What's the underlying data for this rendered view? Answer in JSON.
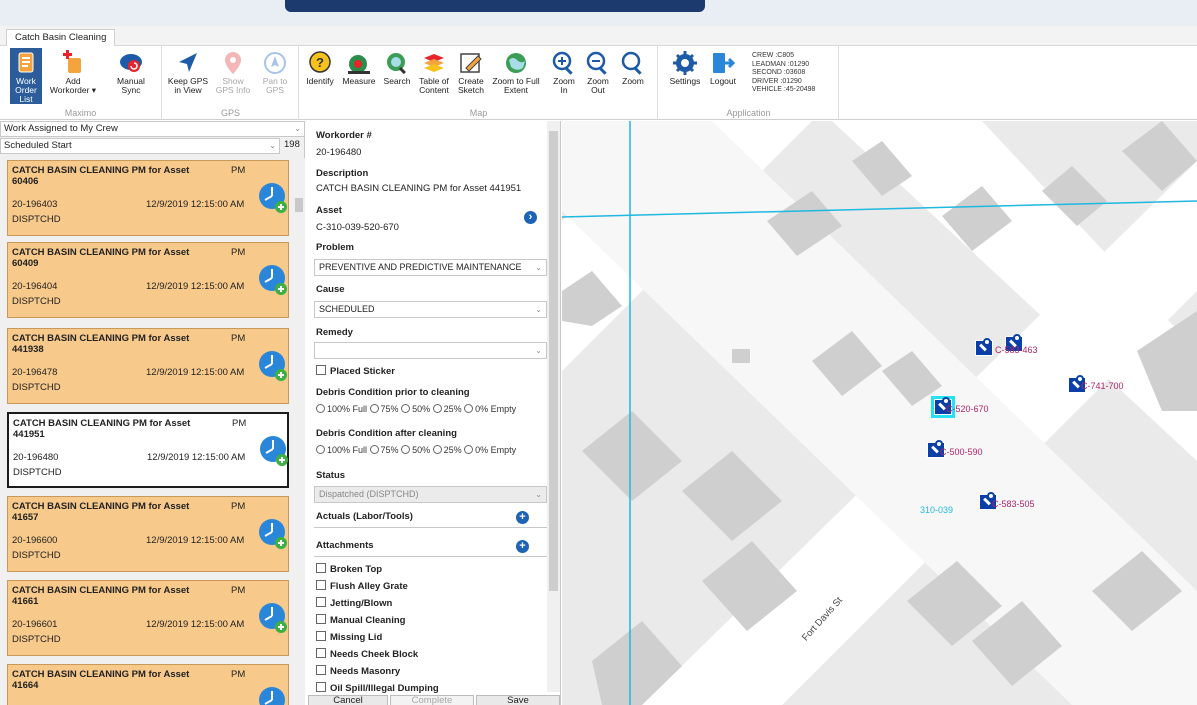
{
  "window": {
    "tab_label": "Catch Basin Cleaning"
  },
  "ribbon": {
    "groups": [
      {
        "title": "Maximo",
        "buttons": [
          {
            "label": "Work\nOrder List",
            "icon": "work-order-list-icon",
            "active": true
          },
          {
            "label": "Add\nWorkorder ▾",
            "icon": "add-workorder-icon"
          },
          {
            "label": "Manual\nSync",
            "icon": "manual-sync-icon"
          }
        ]
      },
      {
        "title": "GPS",
        "buttons": [
          {
            "label": "Keep GPS\nin View",
            "icon": "keep-gps-icon"
          },
          {
            "label": "Show\nGPS Info",
            "icon": "show-gps-info-icon",
            "disabled": true
          },
          {
            "label": "Pan to\nGPS",
            "icon": "pan-to-gps-icon",
            "disabled": true
          }
        ]
      },
      {
        "title": "Map",
        "buttons": [
          {
            "label": "Identify",
            "icon": "identify-icon"
          },
          {
            "label": "Measure",
            "icon": "measure-icon"
          },
          {
            "label": "Search",
            "icon": "search-globe-icon"
          },
          {
            "label": "Table of\nContent",
            "icon": "table-of-content-icon"
          },
          {
            "label": "Create\nSketch",
            "icon": "create-sketch-icon"
          },
          {
            "label": "Zoom to Full\nExtent",
            "icon": "zoom-full-extent-icon"
          },
          {
            "label": "Zoom\nIn",
            "icon": "zoom-in-icon"
          },
          {
            "label": "Zoom\nOut",
            "icon": "zoom-out-icon"
          },
          {
            "label": "Zoom",
            "icon": "zoom-icon"
          }
        ]
      },
      {
        "title": "Application",
        "buttons": [
          {
            "label": "Settings",
            "icon": "settings-icon"
          },
          {
            "label": "Logout",
            "icon": "logout-icon"
          }
        ]
      }
    ],
    "crew_info": [
      "CREW :C805",
      "LEADMAN :01290",
      "SECOND :03608",
      "DRIVER :01290",
      "VEHICLE :45-20498"
    ]
  },
  "list_panel": {
    "filter_value": "Work Assigned to My Crew",
    "sort_value": "Scheduled Start",
    "count": "198",
    "cards": [
      {
        "title": "CATCH BASIN CLEANING PM for Asset 60406",
        "type": "PM",
        "wonum": "20-196403",
        "date": "12/9/2019 12:15:00 AM",
        "status": "DISPTCHD",
        "selected": false
      },
      {
        "title": "CATCH BASIN CLEANING PM for Asset 60409",
        "type": "PM",
        "wonum": "20-196404",
        "date": "12/9/2019 12:15:00 AM",
        "status": "DISPTCHD",
        "selected": false
      },
      {
        "title": "CATCH BASIN CLEANING PM for Asset 441938",
        "type": "PM",
        "wonum": "20-196478",
        "date": "12/9/2019 12:15:00 AM",
        "status": "DISPTCHD",
        "selected": false
      },
      {
        "title": "CATCH BASIN CLEANING PM for Asset 441951",
        "type": "PM",
        "wonum": "20-196480",
        "date": "12/9/2019 12:15:00 AM",
        "status": "DISPTCHD",
        "selected": true
      },
      {
        "title": "CATCH BASIN CLEANING PM for Asset 41657",
        "type": "PM",
        "wonum": "20-196600",
        "date": "12/9/2019 12:15:00 AM",
        "status": "DISPTCHD",
        "selected": false
      },
      {
        "title": "CATCH BASIN CLEANING PM for Asset 41661",
        "type": "PM",
        "wonum": "20-196601",
        "date": "12/9/2019 12:15:00 AM",
        "status": "DISPTCHD",
        "selected": false
      },
      {
        "title": "CATCH BASIN CLEANING PM for Asset 41664",
        "type": "PM",
        "wonum": "",
        "date": "",
        "status": "",
        "selected": false
      }
    ]
  },
  "details": {
    "workorder_label": "Workorder #",
    "workorder_value": "20-196480",
    "description_label": "Description",
    "description_value": "CATCH BASIN CLEANING PM for Asset 441951",
    "asset_label": "Asset",
    "asset_value": "C-310-039-520-670",
    "problem_label": "Problem",
    "problem_value": "PREVENTIVE AND PREDICTIVE MAINTENANCE",
    "cause_label": "Cause",
    "cause_value": "SCHEDULED",
    "remedy_label": "Remedy",
    "remedy_value": "",
    "placed_sticker_label": "Placed Sticker",
    "debris_prior_label": "Debris Condition prior to cleaning",
    "debris_after_label": "Debris Condition after cleaning",
    "debris_options": [
      "100% Full",
      "75%",
      "50%",
      "25%",
      "0% Empty"
    ],
    "status_label": "Status",
    "status_value": "Dispatched (DISPTCHD)",
    "actuals_label": "Actuals (Labor/Tools)",
    "attachments_label": "Attachments",
    "checklist": [
      "Broken Top",
      "Flush Alley Grate",
      "Jetting/Blown",
      "Manual Cleaning",
      "Missing Lid",
      "Needs Cheek Block",
      "Needs Masonry",
      "Oil Spill/Illegal Dumping"
    ],
    "buttons": {
      "cancel": "Cancel",
      "complete": "Complete",
      "save": "Save"
    }
  },
  "map": {
    "labels": [
      "C-583-463",
      "C-741-700",
      "C-520-670",
      "C-500-590",
      "C-583-505",
      "310-039"
    ],
    "street_name": "Fort Davis St",
    "line_color": "#1fb8e0",
    "label_color": "#b0246b"
  }
}
